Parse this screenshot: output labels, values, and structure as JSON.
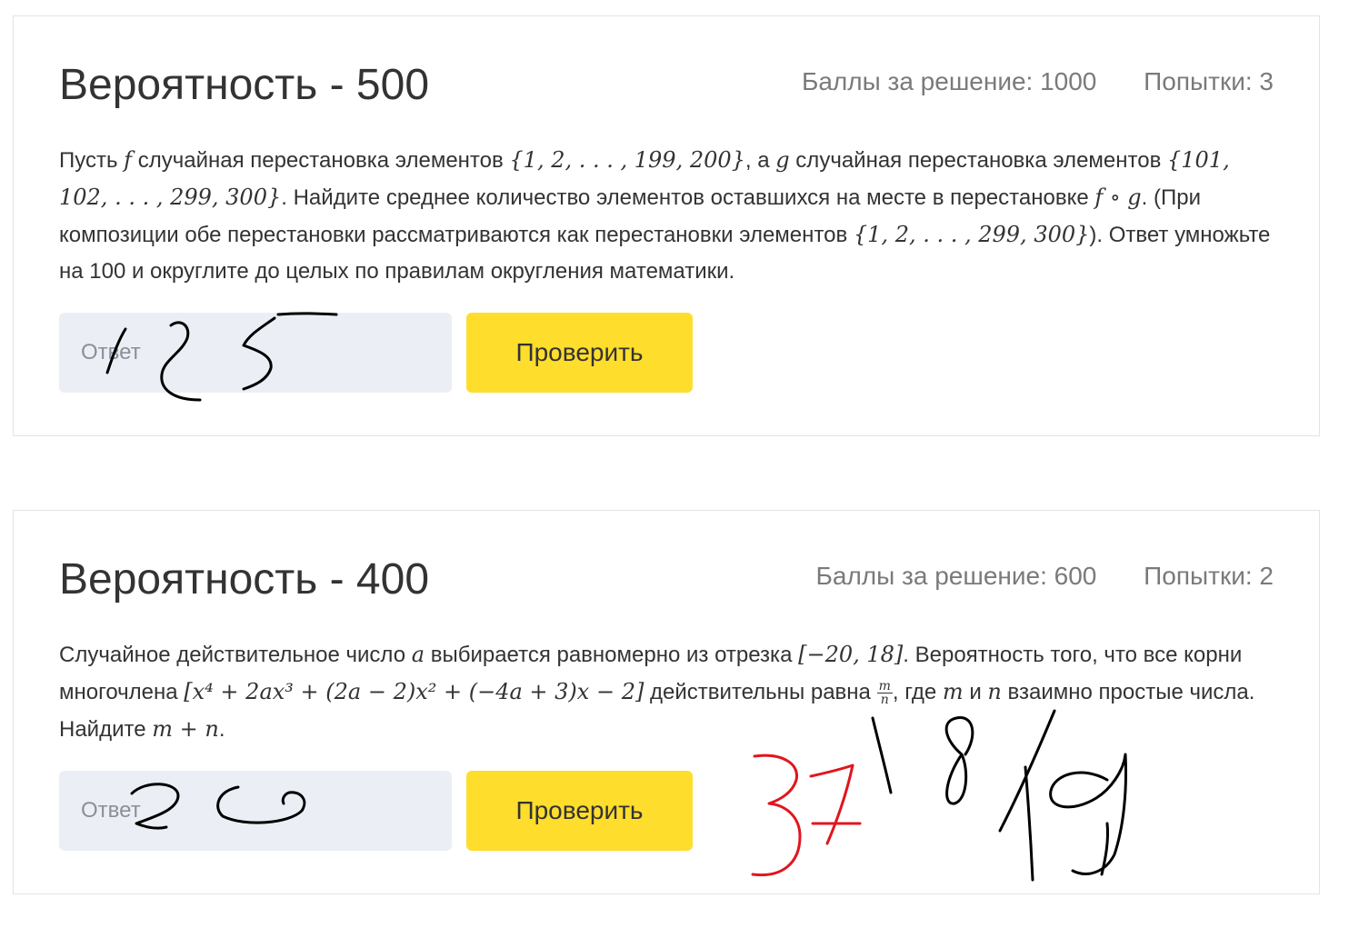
{
  "problems": [
    {
      "title": "Вероятность - 500",
      "points_label": "Баллы за решение: 1000",
      "attempts_label": "Попытки: 3",
      "statement": {
        "t1": "Пусть ",
        "m1": "f",
        "t2": " случайная перестановка элементов ",
        "m2": "{1, 2, . . . , 199, 200}",
        "t3": ", а ",
        "m3": "g",
        "t4": " случайная перестановка элементов ",
        "m4": "{101, 102, . . . , 299, 300}",
        "t5": ". Найдите среднее количество элементов оставшихся на месте в перестановке ",
        "m5": "f ∘ g",
        "t6": ". (При композиции обе перестановки рассматриваются как перестановки элементов ",
        "m6": "{1, 2, . . . , 299, 300}",
        "t7": "). Ответ умножьте на 100 и округлите до целых по правилам округления математики."
      },
      "answer_placeholder": "Ответ",
      "check_label": "Проверить"
    },
    {
      "title": "Вероятность - 400",
      "points_label": "Баллы за решение: 600",
      "attempts_label": "Попытки: 2",
      "statement": {
        "t1": "Случайное действительное число ",
        "m1": "a",
        "t2": " выбирается равномерно из отрезка ",
        "m2": "[−20, 18]",
        "t3": ". Вероятность того, что все корни многочлена ",
        "m3": "[x⁴ + 2ax³ + (2a − 2)x² + (−4a + 3)x − 2]",
        "t4": " действительны равна ",
        "frac_num": "m",
        "frac_den": "n",
        "t5": ", где ",
        "m4": "m",
        "t6": " и ",
        "m5": "n",
        "t7": " взаимно простые числа. Найдите ",
        "m6": "m + n",
        "t8": "."
      },
      "answer_placeholder": "Ответ",
      "check_label": "Проверить"
    }
  ],
  "annotations": {
    "ink_black": "#000000",
    "ink_red": "#e0161e"
  }
}
